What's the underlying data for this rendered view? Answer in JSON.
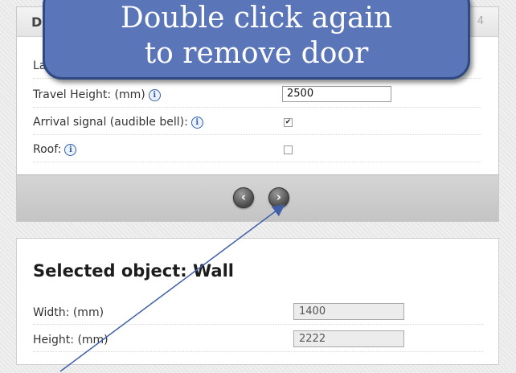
{
  "panel_top": {
    "header_letter": "D",
    "header_number": "4",
    "rows": [
      {
        "label": "Landi",
        "type": "text",
        "value": ""
      },
      {
        "label": "Travel Height: (mm)",
        "type": "text",
        "value": "2500"
      },
      {
        "label": "Arrival signal (audible bell):",
        "type": "checkbox",
        "checked": true
      },
      {
        "label": "Roof:",
        "type": "checkbox",
        "checked": false
      }
    ],
    "info_glyph": "i",
    "prev_glyph": "‹",
    "next_glyph": "›"
  },
  "selected": {
    "title": "Selected object: Wall",
    "fields": [
      {
        "label": "Width: (mm)",
        "value": "1400"
      },
      {
        "label": "Height: (mm)",
        "value": "2222"
      }
    ]
  },
  "callout": {
    "line1": "Double click again",
    "line2": "to remove door",
    "color": "#5a75b8"
  },
  "checked_glyph": "✔"
}
